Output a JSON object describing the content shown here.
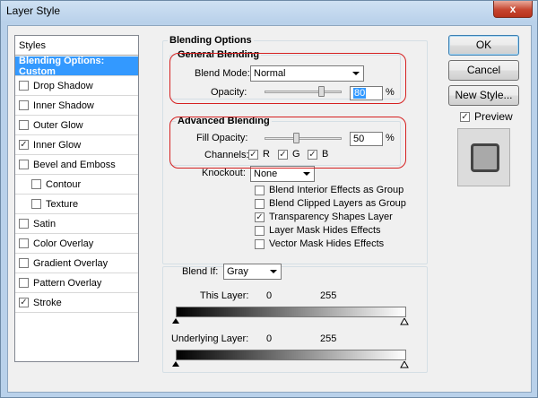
{
  "window": {
    "title": "Layer Style",
    "close_glyph": "x"
  },
  "styles": {
    "header": "Styles",
    "items": [
      {
        "label": "Blending Options: Custom",
        "active": true,
        "checkbox": false,
        "checked": false,
        "sub": false
      },
      {
        "label": "Drop Shadow",
        "active": false,
        "checkbox": true,
        "checked": false,
        "sub": false
      },
      {
        "label": "Inner Shadow",
        "active": false,
        "checkbox": true,
        "checked": false,
        "sub": false
      },
      {
        "label": "Outer Glow",
        "active": false,
        "checkbox": true,
        "checked": false,
        "sub": false
      },
      {
        "label": "Inner Glow",
        "active": false,
        "checkbox": true,
        "checked": true,
        "sub": false
      },
      {
        "label": "Bevel and Emboss",
        "active": false,
        "checkbox": true,
        "checked": false,
        "sub": false
      },
      {
        "label": "Contour",
        "active": false,
        "checkbox": true,
        "checked": false,
        "sub": true
      },
      {
        "label": "Texture",
        "active": false,
        "checkbox": true,
        "checked": false,
        "sub": true
      },
      {
        "label": "Satin",
        "active": false,
        "checkbox": true,
        "checked": false,
        "sub": false
      },
      {
        "label": "Color Overlay",
        "active": false,
        "checkbox": true,
        "checked": false,
        "sub": false
      },
      {
        "label": "Gradient Overlay",
        "active": false,
        "checkbox": true,
        "checked": false,
        "sub": false
      },
      {
        "label": "Pattern Overlay",
        "active": false,
        "checkbox": true,
        "checked": false,
        "sub": false
      },
      {
        "label": "Stroke",
        "active": false,
        "checkbox": true,
        "checked": true,
        "sub": false
      }
    ]
  },
  "blending": {
    "title": "Blending Options",
    "general": {
      "title": "General Blending",
      "blend_mode_label": "Blend Mode:",
      "blend_mode_value": "Normal",
      "opacity_label": "Opacity:",
      "opacity_value": "80",
      "opacity_unit": "%"
    },
    "advanced": {
      "title": "Advanced Blending",
      "fill_opacity_label": "Fill Opacity:",
      "fill_opacity_value": "50",
      "fill_opacity_unit": "%",
      "channels_label": "Channels:",
      "channel_r": "R",
      "channel_g": "G",
      "channel_b": "B",
      "knockout_label": "Knockout:",
      "knockout_value": "None",
      "options": [
        {
          "label": "Blend Interior Effects as Group",
          "checked": false
        },
        {
          "label": "Blend Clipped Layers as Group",
          "checked": false
        },
        {
          "label": "Transparency Shapes Layer",
          "checked": true
        },
        {
          "label": "Layer Mask Hides Effects",
          "checked": false
        },
        {
          "label": "Vector Mask Hides Effects",
          "checked": false
        }
      ]
    },
    "blend_if": {
      "label": "Blend If:",
      "value": "Gray",
      "this_layer_label": "This Layer:",
      "this_layer_min": "0",
      "this_layer_max": "255",
      "underlying_label": "Underlying Layer:",
      "underlying_min": "0",
      "underlying_max": "255"
    }
  },
  "buttons": {
    "ok": "OK",
    "cancel": "Cancel",
    "new_style": "New Style...",
    "preview_label": "Preview",
    "preview_checked": true
  },
  "check_glyph": "✓",
  "colors": {
    "selection": "#3399ff",
    "highlight_oval": "#d62020"
  }
}
